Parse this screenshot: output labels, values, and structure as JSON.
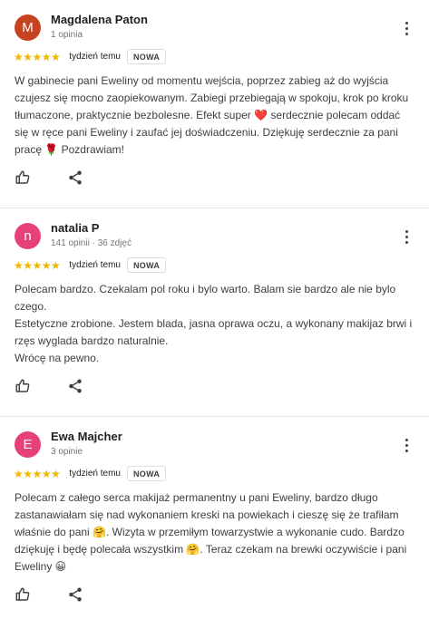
{
  "reviews": [
    {
      "initial": "M",
      "avatar_color": "#c5431f",
      "name": "Magdalena Paton",
      "meta": "1 opinia",
      "stars": "★★★★★",
      "rating": 5,
      "time": "tydzień temu",
      "badge": "NOWA",
      "text": "W gabinecie pani Eweliny od momentu wejścia, poprzez zabieg aż do wyjścia czujesz się mocno zaopiekowanym. Zabiegi przebiegają w spokoju, krok po kroku tłumaczone, praktycznie bezbolesne. Efekt super ❤️ serdecznie polecam oddać się w ręce pani Eweliny i zaufać jej doświadczeniu. Dziękuję serdecznie za pani pracę 🌹 Pozdrawiam!"
    },
    {
      "initial": "n",
      "avatar_color": "#e8407a",
      "name": "natalia P",
      "meta": "141 opinii · 36 zdjęć",
      "stars": "★★★★★",
      "rating": 5,
      "time": "tydzień temu",
      "badge": "NOWA",
      "text": "Polecam bardzo. Czekalam pol roku i bylo warto. Balam sie bardzo ale nie bylo czego.\nEstetyczne zrobione. Jestem blada, jasna oprawa oczu, a wykonany makijaz brwi i rzęs wyglada bardzo naturalnie.\nWrócę na pewno."
    },
    {
      "initial": "E",
      "avatar_color": "#e8407a",
      "name": "Ewa Majcher",
      "meta": "3 opinie",
      "stars": "★★★★★",
      "rating": 5,
      "time": "tydzień temu",
      "badge": "NOWA",
      "text": "Polecam z całego serca makijaż permanentny u pani Eweliny, bardzo długo zastanawiałam się nad wykonaniem kreski na powiekach i cieszę się że trafiłam właśnie do pani 🤗. Wizyta w przemiłym towarzystwie a wykonanie cudo. Bardzo dziękuję i będę polecała wszystkim 🤗. Teraz czekam na brewki oczywiście i pani Eweliny 😀"
    }
  ],
  "icons": {
    "like": "thumbs-up-icon",
    "share": "share-icon",
    "menu": "more-vert-icon"
  }
}
